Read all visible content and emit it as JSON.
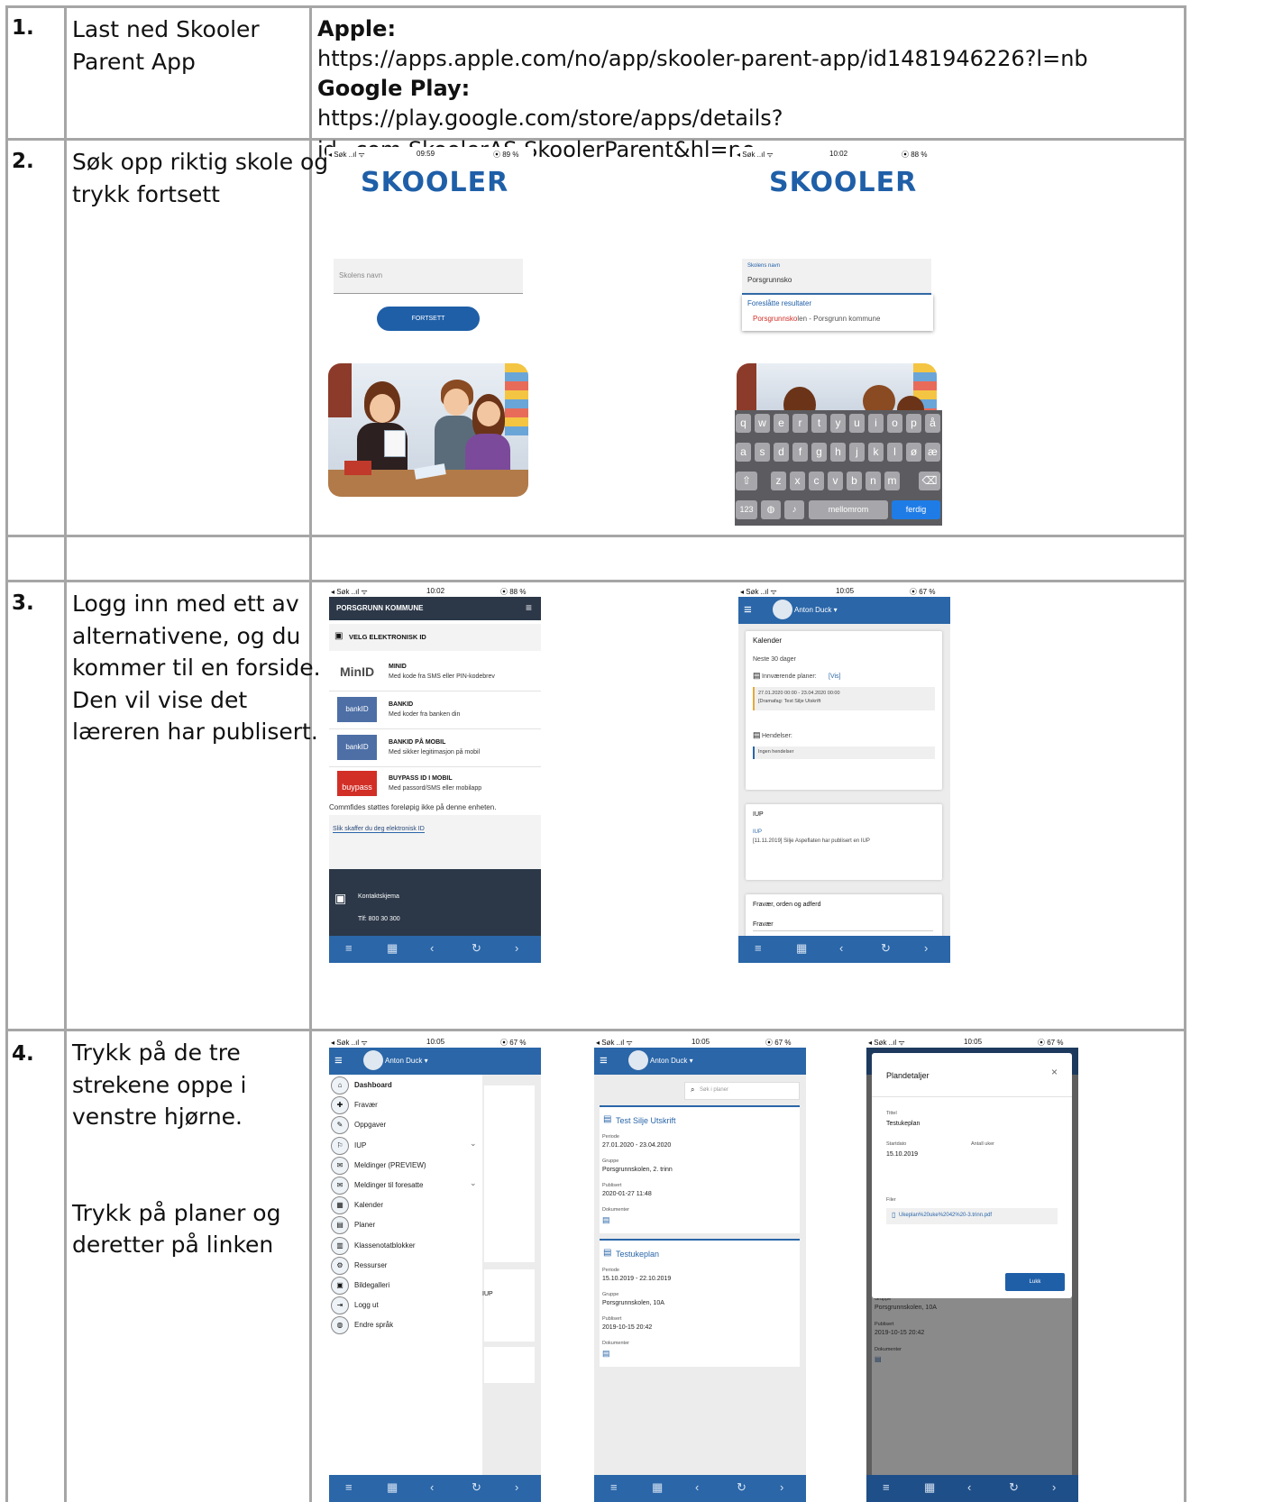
{
  "rows": [
    {
      "number": "1.",
      "text": "Last ned Skooler\nParent App",
      "apple_label": "Apple:",
      "apple_url": "https://apps.apple.com/no/app/skooler-parent-app/id1481946226?l=nb",
      "google_label": "Google Play:",
      "google_url": "https://play.google.com/store/apps/details?id=com.SkoolerAS.SkoolerParent&hl=no"
    },
    {
      "number": "2.",
      "text": "Søk opp riktig skole og\ntrykk fortsett",
      "screen_a": {
        "status_left": "◂ Søk ..ıl ᯤ",
        "status_time": "09:59",
        "status_right": "⦿ 89 %",
        "logo": "SKOOLER",
        "input_placeholder": "Skolens navn",
        "button_label": "FORTSETT"
      },
      "screen_b": {
        "status_left": "◂ Søk ..ıl ᯤ",
        "status_time": "10:02",
        "status_right": "⦿ 88 %",
        "logo": "SKOOLER",
        "input_label": "Skolens navn",
        "input_value": "Porsgrunnsko",
        "suggest_header": "Foreslåtte resultater",
        "suggest_match": "Porsgrunnsko",
        "suggest_rest": "len - Porsgrunn kommune",
        "keyboard_row1": [
          "q",
          "w",
          "e",
          "r",
          "t",
          "y",
          "u",
          "i",
          "o",
          "p",
          "å"
        ],
        "keyboard_row2": [
          "a",
          "s",
          "d",
          "f",
          "g",
          "h",
          "j",
          "k",
          "l",
          "ø",
          "æ"
        ],
        "keyboard_row3": [
          "z",
          "x",
          "c",
          "v",
          "b",
          "n",
          "m"
        ],
        "key_123": "123",
        "key_space": "mellomrom",
        "key_done": "ferdig"
      }
    },
    {
      "number": "3.",
      "text": "Logg inn med ett av\nalternativene, og du\nkommer til en forside.\nDen vil vise det\nlæreren har publisert.",
      "screen_a": {
        "status_left": "◂ Søk ..ıl ᯤ",
        "status_time": "10:02",
        "status_right": "⦿ 88 %",
        "header": "PORSGRUNN KOMMUNE",
        "section": "VELG ELEKTRONISK ID",
        "options": [
          {
            "logo": "MinID",
            "title": "MINID",
            "desc": "Med kode fra SMS eller PIN-kodebrev"
          },
          {
            "logo": "bankID",
            "title": "BANKID",
            "desc": "Med koder fra banken din"
          },
          {
            "logo": "bankID",
            "title": "BANKID PÅ MOBIL",
            "desc": "Med sikker legitimasjon på mobil"
          },
          {
            "logo": "buypass",
            "title": "BUYPASS ID I MOBIL",
            "desc": "Med passord/SMS eller mobilapp"
          }
        ],
        "notice": "Commfides støttes foreløpig ikke på denne enheten.",
        "help_link": "Slik skaffer du deg elektronisk ID",
        "contact": "Kontaktskjema",
        "phone": "Tlf: 800 30 300"
      },
      "screen_b": {
        "status_left": "◂ Søk ..ıl ᯤ",
        "status_time": "10:05",
        "status_right": "⦿ 67 %",
        "user": "Anton Duck ▾",
        "calendar_title": "Kalender",
        "next_days": "Neste 30 dager",
        "current_plans": "Innværende planer:",
        "show_link": "[Vis]",
        "plan_dates": "27.01.2020 00:00 - 23.04.2020 00:00",
        "plan_name": "[Dramafag: Test Silje Utskrift",
        "events": "Hendelser:",
        "no_events": "Ingen hendelser",
        "iup_title": "IUP",
        "iup_link": "IUP",
        "iup_text": "[11.11.2019] Silje Aspeflaten har publisert en IUP",
        "absence_title": "Fravær, orden og adferd",
        "absence": "Fravær"
      }
    },
    {
      "number": "4.",
      "text": "Trykk på de tre\nstrekene oppe i\nvenstre hjørne.\n\n\nTrykk på planer og\nderetter på linken",
      "screen_a": {
        "status_left": "◂ Søk ..ıl ᯤ",
        "status_time": "10:05",
        "status_right": "⦿ 67 %",
        "user": "Anton Duck ▾",
        "menu": [
          "Dashboard",
          "Fravær",
          "Oppgaver",
          "IUP",
          "Meldinger (PREVIEW)",
          "Meldinger til foresatte",
          "Kalender",
          "Planer",
          "Klassenotatblokker",
          "Ressurser",
          "Bildegalleri",
          "Logg ut",
          "Endre språk"
        ],
        "side_label": "IUP"
      },
      "screen_b": {
        "status_left": "◂ Søk ..ıl ᯤ",
        "status_time": "10:05",
        "status_right": "⦿ 67 %",
        "user": "Anton Duck ▾",
        "search_placeholder": "Søk i planer",
        "plans": [
          {
            "title": "Test Silje Utskrift",
            "period_label": "Periode",
            "period": "27.01.2020 - 23.04.2020",
            "group_label": "Gruppe",
            "group": "Porsgrunnskolen, 2. trinn",
            "pub_label": "Publisert",
            "published": "2020-01-27 11:48",
            "docs_label": "Dokumenter"
          },
          {
            "title": "Testukeplan",
            "period_label": "Periode",
            "period": "15.10.2019 - 22.10.2019",
            "group_label": "Gruppe",
            "group": "Porsgrunnskolen, 10A",
            "pub_label": "Publisert",
            "published": "2019-10-15 20:42",
            "docs_label": "Dokumenter"
          }
        ]
      },
      "screen_c": {
        "status_left": "◂ Søk ..ıl ᯤ",
        "status_time": "10:05",
        "status_right": "⦿ 67 %",
        "title": "Plandetaljer",
        "close": "×",
        "title_label": "Tittel",
        "title_value": "Testukeplan",
        "start_label": "Startdato",
        "start_value": "15.10.2019",
        "weeks_label": "Antall uker",
        "files_label": "Filer",
        "file": "Ukeplan%20uke%2042%20-3.trinn.pdf",
        "close_button": "Lukk",
        "bg_group_label": "Gruppe",
        "bg_group": "Porsgrunnskolen, 10A",
        "bg_pub_label": "Publisert",
        "bg_published": "2019-10-15 20:42",
        "bg_docs_label": "Dokumenter"
      }
    }
  ],
  "nav_icons": [
    "≡",
    "▦",
    "‹",
    "↻",
    "›"
  ],
  "colors": {
    "brand_blue": "#2a66a8",
    "dark_header": "#2c3848",
    "grid": "#a6a6a6",
    "accent_red": "#d22f27"
  }
}
